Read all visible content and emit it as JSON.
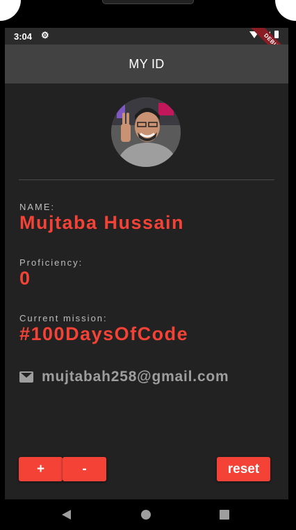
{
  "status_bar": {
    "time": "3:04"
  },
  "debug_banner": "DEBUG",
  "app_bar": {
    "title": "MY ID"
  },
  "profile": {
    "name_label": "NAME:",
    "name_value": "Mujtaba Hussain",
    "proficiency_label": "Proficiency:",
    "proficiency_value": "0",
    "mission_label": "Current mission:",
    "mission_value": "#100DaysOfCode",
    "email": "mujtabah258@gmail.com"
  },
  "buttons": {
    "increment": "+",
    "decrement": "-",
    "reset": "reset"
  },
  "colors": {
    "accent": "#f44336",
    "background": "#222222",
    "app_bar": "#424242"
  }
}
